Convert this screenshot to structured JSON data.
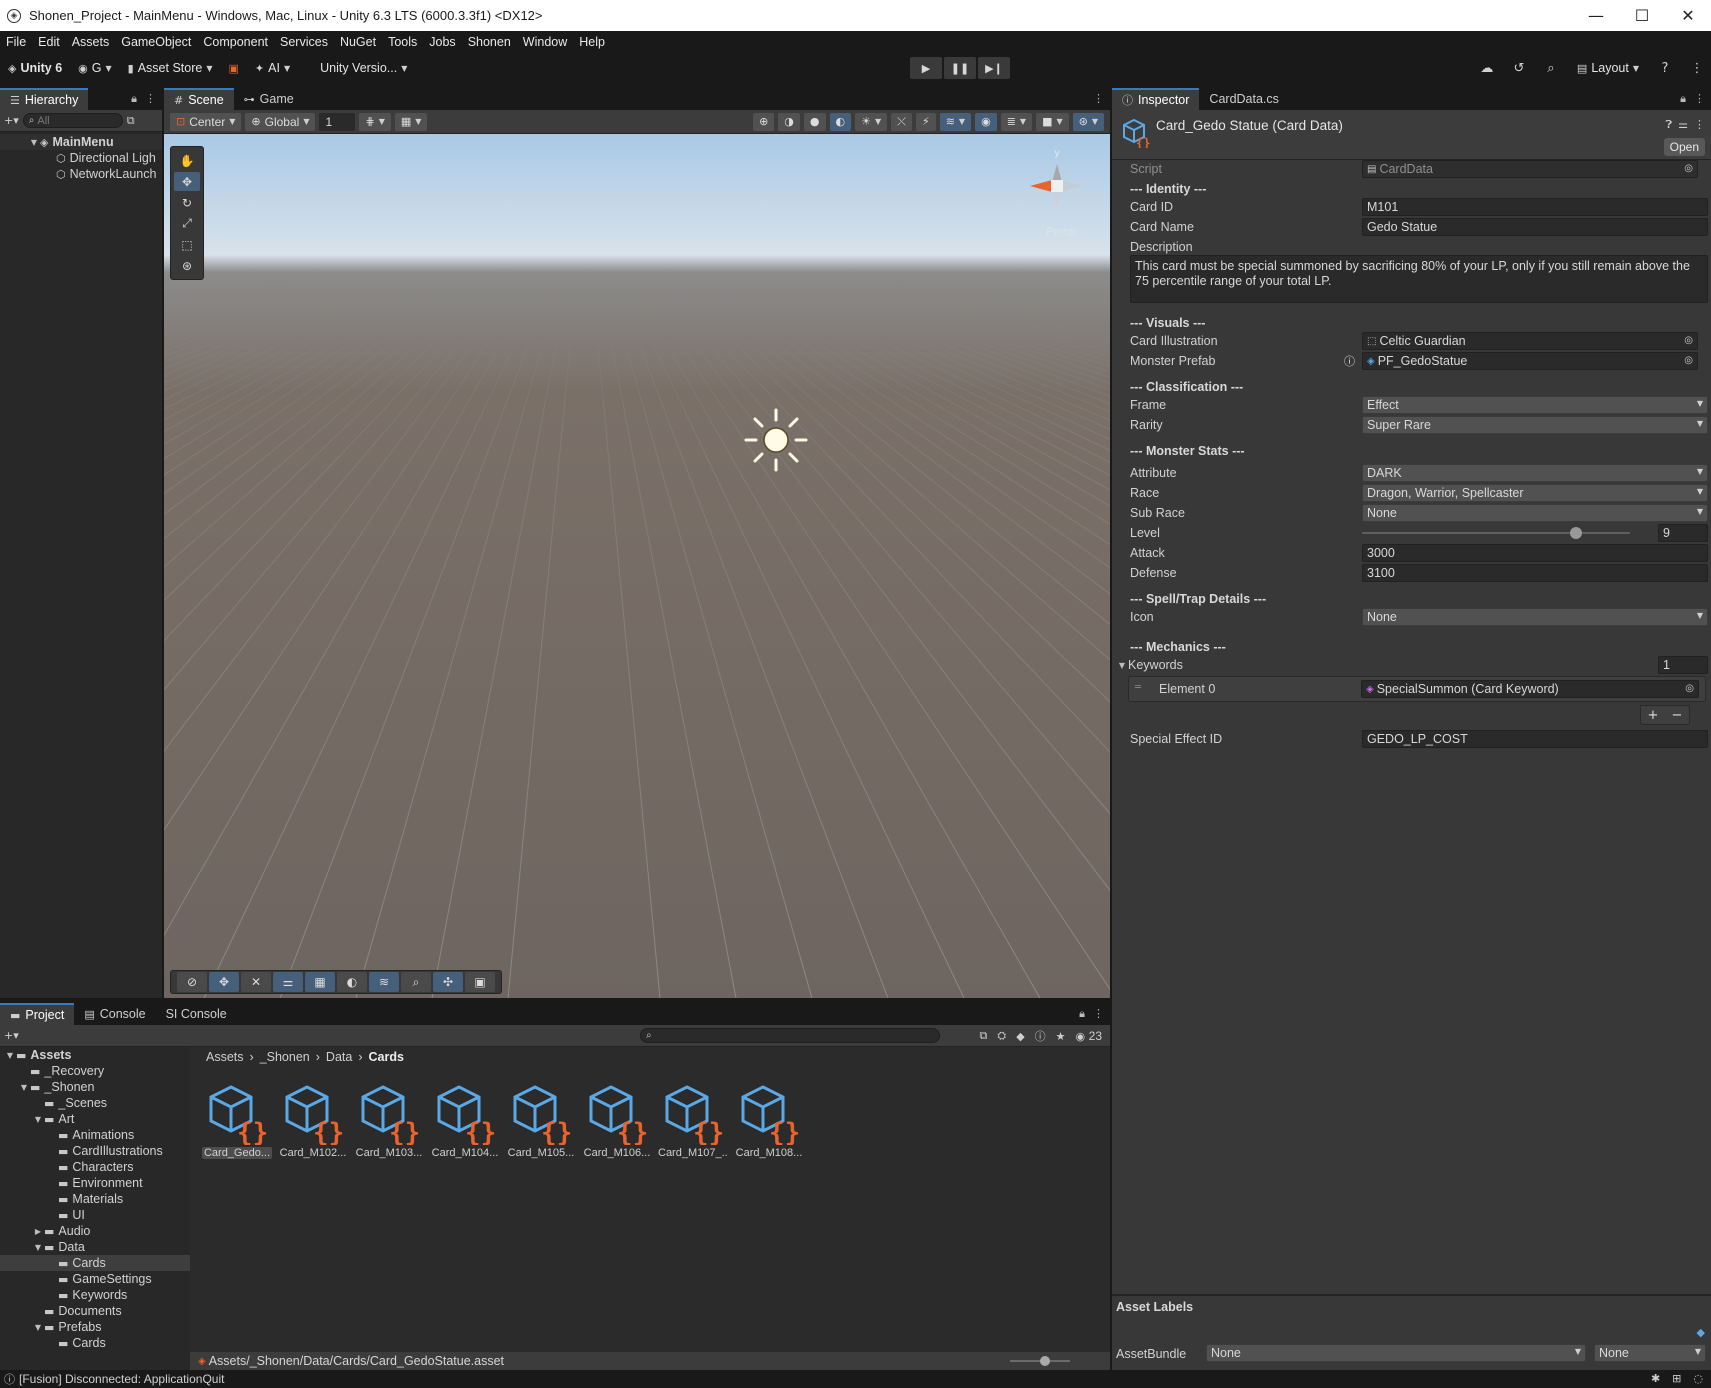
{
  "window": {
    "title": "Shonen_Project - MainMenu - Windows, Mac, Linux - Unity 6.3 LTS (6000.3.3f1) <DX12>",
    "minimize": "—",
    "maximize": "☐",
    "close": "✕"
  },
  "menu": [
    "File",
    "Edit",
    "Assets",
    "GameObject",
    "Component",
    "Services",
    "NuGet",
    "Tools",
    "Jobs",
    "Shonen",
    "Window",
    "Help"
  ],
  "toolbar": {
    "unity_label": "Unity 6",
    "account": "G",
    "asset_store": "Asset Store",
    "ai": "AI",
    "version_control": "Unity Versio...",
    "layout": "Layout"
  },
  "hierarchy": {
    "tab": "Hierarchy",
    "search_placeholder": "All",
    "scene": "MainMenu",
    "items": [
      "Directional Ligh",
      "NetworkLaunch"
    ]
  },
  "scene": {
    "tabs": [
      "Scene",
      "Game"
    ],
    "pivot": "Center",
    "space": "Global",
    "snap_value": "1",
    "persp_label": "Persp",
    "gizmo_axis": "y"
  },
  "inspector": {
    "tabs": [
      "Inspector",
      "CardData.cs"
    ],
    "title": "Card_Gedo Statue (Card Data)",
    "open_button": "Open",
    "script_label": "Script",
    "script_value": "CardData",
    "identity_header": "--- Identity ---",
    "card_id_label": "Card ID",
    "card_id": "M101",
    "card_name_label": "Card Name",
    "card_name": "Gedo Statue",
    "description_label": "Description",
    "description": "This card must be special summoned by sacrificing 80% of your LP, only if you still remain above the 75 percentile range of your total LP.",
    "visuals_header": "--- Visuals ---",
    "illustration_label": "Card Illustration",
    "illustration": "Celtic Guardian",
    "prefab_label": "Monster Prefab",
    "prefab": "PF_GedoStatue",
    "classification_header": "--- Classification ---",
    "frame_label": "Frame",
    "frame": "Effect",
    "rarity_label": "Rarity",
    "rarity": "Super Rare",
    "stats_header": "--- Monster Stats ---",
    "attribute_label": "Attribute",
    "attribute": "DARK",
    "race_label": "Race",
    "race": "Dragon, Warrior, Spellcaster",
    "subrace_label": "Sub Race",
    "subrace": "None",
    "level_label": "Level",
    "level": "9",
    "level_fraction": 0.8,
    "attack_label": "Attack",
    "attack": "3000",
    "defense_label": "Defense",
    "defense": "3100",
    "spelltrap_header": "--- Spell/Trap Details ---",
    "icon_label": "Icon",
    "icon": "None",
    "mechanics_header": "--- Mechanics ---",
    "keywords_label": "Keywords",
    "keywords_count": "1",
    "element0_label": "Element 0",
    "element0": "SpecialSummon (Card Keyword)",
    "add_btn": "+",
    "remove_btn": "−",
    "special_effect_label": "Special Effect ID",
    "special_effect": "GEDO_LP_COST",
    "asset_labels": "Asset Labels",
    "assetbundle_label": "AssetBundle",
    "assetbundle_name": "None",
    "assetbundle_variant": "None"
  },
  "project": {
    "tabs": [
      "Project",
      "Console",
      "SI Console"
    ],
    "hidden_count": "23",
    "tree": [
      {
        "label": "Assets",
        "depth": 0,
        "arrow": "▼",
        "bold": true
      },
      {
        "label": "_Recovery",
        "depth": 1,
        "arrow": ""
      },
      {
        "label": "_Shonen",
        "depth": 1,
        "arrow": "▼"
      },
      {
        "label": "_Scenes",
        "depth": 2,
        "arrow": ""
      },
      {
        "label": "Art",
        "depth": 2,
        "arrow": "▼"
      },
      {
        "label": "Animations",
        "depth": 3,
        "arrow": ""
      },
      {
        "label": "CardIllustrations",
        "depth": 3,
        "arrow": ""
      },
      {
        "label": "Characters",
        "depth": 3,
        "arrow": ""
      },
      {
        "label": "Environment",
        "depth": 3,
        "arrow": ""
      },
      {
        "label": "Materials",
        "depth": 3,
        "arrow": ""
      },
      {
        "label": "UI",
        "depth": 3,
        "arrow": ""
      },
      {
        "label": "Audio",
        "depth": 2,
        "arrow": "▶"
      },
      {
        "label": "Data",
        "depth": 2,
        "arrow": "▼"
      },
      {
        "label": "Cards",
        "depth": 3,
        "arrow": "",
        "selected": true
      },
      {
        "label": "GameSettings",
        "depth": 3,
        "arrow": ""
      },
      {
        "label": "Keywords",
        "depth": 3,
        "arrow": ""
      },
      {
        "label": "Documents",
        "depth": 2,
        "arrow": ""
      },
      {
        "label": "Prefabs",
        "depth": 2,
        "arrow": "▼"
      },
      {
        "label": "Cards",
        "depth": 3,
        "arrow": ""
      }
    ],
    "breadcrumb": [
      "Assets",
      "_Shonen",
      "Data",
      "Cards"
    ],
    "assets": [
      "Card_Gedo...",
      "Card_M102...",
      "Card_M103...",
      "Card_M104...",
      "Card_M105...",
      "Card_M106...",
      "Card_M107_...",
      "Card_M108..."
    ],
    "path": "Assets/_Shonen/Data/Cards/Card_GedoStatue.asset"
  },
  "status": {
    "message": "[Fusion] Disconnected: ApplicationQuit"
  },
  "colors": {
    "accent": "#3a79bb",
    "asset_blue": "#5aa9e6",
    "asset_orange": "#e8642c"
  }
}
